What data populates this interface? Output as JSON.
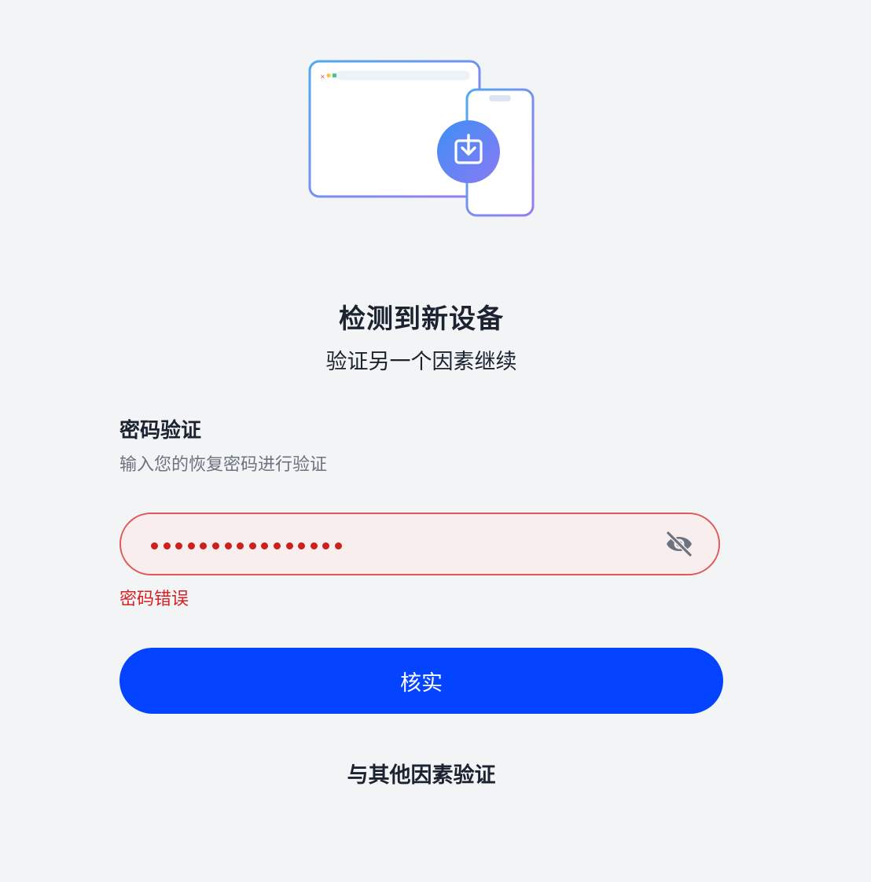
{
  "header": {
    "title": "检测到新设备",
    "subtitle": "验证另一个因素继续"
  },
  "password_section": {
    "title": "密码验证",
    "description": "输入您的恢复密码进行验证",
    "masked_length": 16,
    "error": "密码错误"
  },
  "actions": {
    "verify_label": "核实",
    "alternative_label": "与其他因素验证"
  },
  "icons": {
    "illustration": "new-device-download-illustration",
    "visibility_toggle": "eye-off-icon"
  },
  "colors": {
    "background": "#f2f4f6",
    "primary": "#0443ff",
    "error": "#d62222",
    "error_border": "#e05a5a",
    "error_fill": "#f8eeee",
    "text": "#1b2230",
    "muted": "#6b7280"
  }
}
